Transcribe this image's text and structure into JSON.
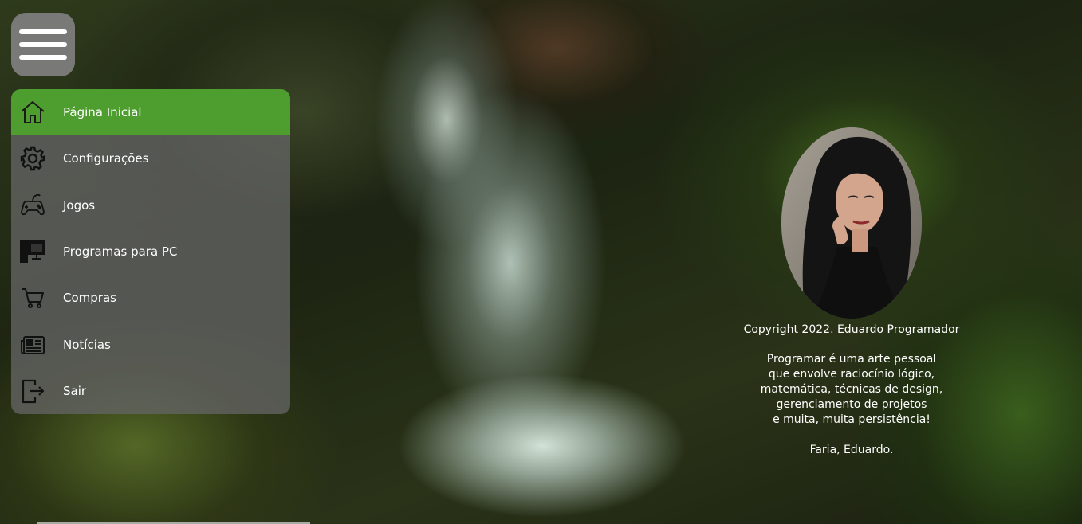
{
  "menu": {
    "items": [
      {
        "label": "Página Inicial",
        "icon": "home-icon",
        "active": true
      },
      {
        "label": "Configurações",
        "icon": "gear-icon",
        "active": false
      },
      {
        "label": "Jogos",
        "icon": "gamepad-icon",
        "active": false
      },
      {
        "label": "Programas para PC",
        "icon": "desktop-computer-icon",
        "active": false
      },
      {
        "label": "Compras",
        "icon": "shopping-cart-icon",
        "active": false
      },
      {
        "label": "Notícias",
        "icon": "newspaper-icon",
        "active": false
      },
      {
        "label": "Sair",
        "icon": "logout-icon",
        "active": false
      }
    ]
  },
  "profile": {
    "copyright": "Copyright 2022. Eduardo Programador",
    "quote": [
      "Programar é uma arte pessoal",
      "que envolve raciocínio lógico,",
      "matemática, técnicas de design,",
      "gerenciamento de projetos",
      "e muita, muita persistência!"
    ],
    "signature": "Faria, Eduardo."
  },
  "colors": {
    "active_item": "#4e9e2f",
    "menu_panel": "#646464",
    "toggle_button": "#808080"
  }
}
